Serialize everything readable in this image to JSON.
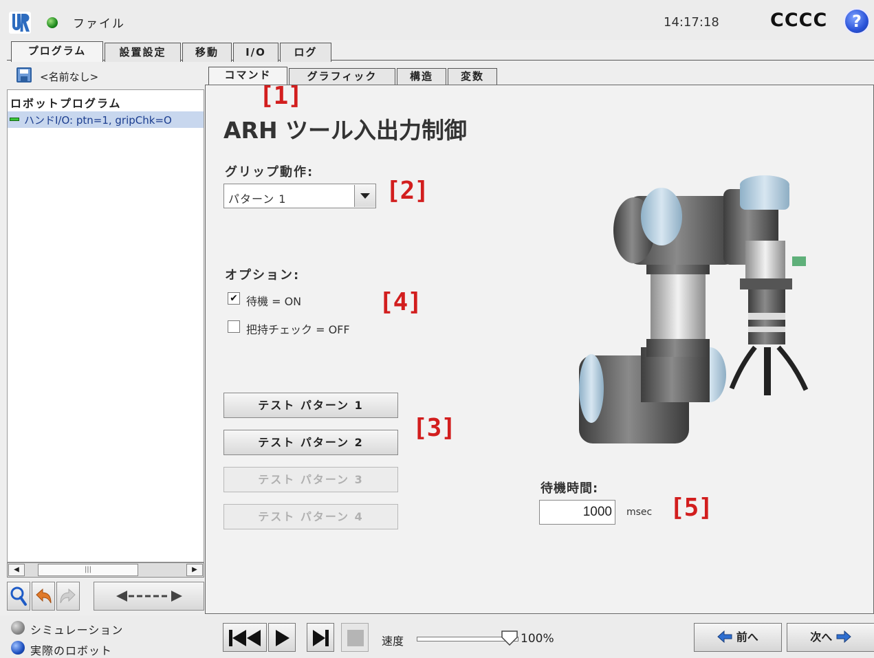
{
  "topbar": {
    "file_menu": "ファイル",
    "time": "14:17:18",
    "robot_name": "CCCC",
    "help_glyph": "?"
  },
  "main_tabs": [
    "プログラム",
    "設置設定",
    "移動",
    "I/O",
    "ログ"
  ],
  "active_main_tab": "プログラム",
  "left_panel": {
    "program_name": "<名前なし>",
    "tree_root": "ロボットプログラム",
    "tree_node": "ハンドI/O: ptn=1, gripChk=O",
    "scroll_thumb_glyph": "|||"
  },
  "sub_tabs": [
    "コマンド",
    "グラフィック",
    "構造",
    "変数"
  ],
  "active_sub_tab": "コマンド",
  "command": {
    "title": "ARH ツール入出力制御",
    "grip_label": "グリップ動作:",
    "grip_value": "パターン 1",
    "options_label": "オプション:",
    "option_wait": "待機 = ON",
    "option_wait_checked": true,
    "option_grip_check": "把持チェック = OFF",
    "option_grip_check_checked": false,
    "tests": [
      "テスト パターン 1",
      "テスト パターン 2",
      "テスト パターン 3",
      "テスト パターン 4"
    ],
    "tests_enabled": [
      true,
      true,
      false,
      false
    ],
    "wait_label": "待機時間:",
    "wait_value": "1000",
    "wait_unit": "msec",
    "check_glyph": "✔"
  },
  "markers": [
    "[1]",
    "[2]",
    "[3]",
    "[4]",
    "[5]"
  ],
  "bottombar": {
    "sim_label": "シミュレーション",
    "real_label": "実際のロボット",
    "speed_label": "速度",
    "speed_value": "100%",
    "speed_fraction": 1.0,
    "prev_label": "前へ",
    "next_label": "次へ"
  },
  "colors": {
    "marker_red": "#d21e1e",
    "selection_blue": "#c8d7ee",
    "ur_blue": "#2d5fa0"
  },
  "icons": [
    "ur-logo-icon",
    "status-dot-icon",
    "help-icon",
    "save-icon",
    "zoom-icon",
    "undo-icon",
    "redo-icon",
    "move-node-icon",
    "rewind-icon",
    "play-icon",
    "step-icon",
    "stop-icon",
    "prev-arrow-icon",
    "next-arrow-icon"
  ]
}
